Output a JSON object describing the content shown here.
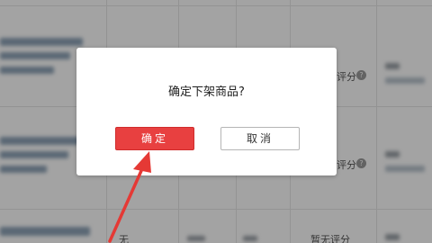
{
  "dialog": {
    "message": "确定下架商品?",
    "confirm_label": "确定",
    "cancel_label": "取消"
  },
  "table": {
    "rows": [
      {
        "rating_fragment": "评分",
        "help_icon": "?"
      },
      {
        "rating_fragment": "评分",
        "help_icon": "?"
      },
      {
        "status_char": "无",
        "rating_text": "暂无评分"
      }
    ]
  },
  "colors": {
    "overlay": "#000000",
    "confirm_button": "#e84040",
    "arrow": "#e53935"
  },
  "icons": {
    "help": "question-circle-icon",
    "annotation": "red-arrow-annotation"
  }
}
